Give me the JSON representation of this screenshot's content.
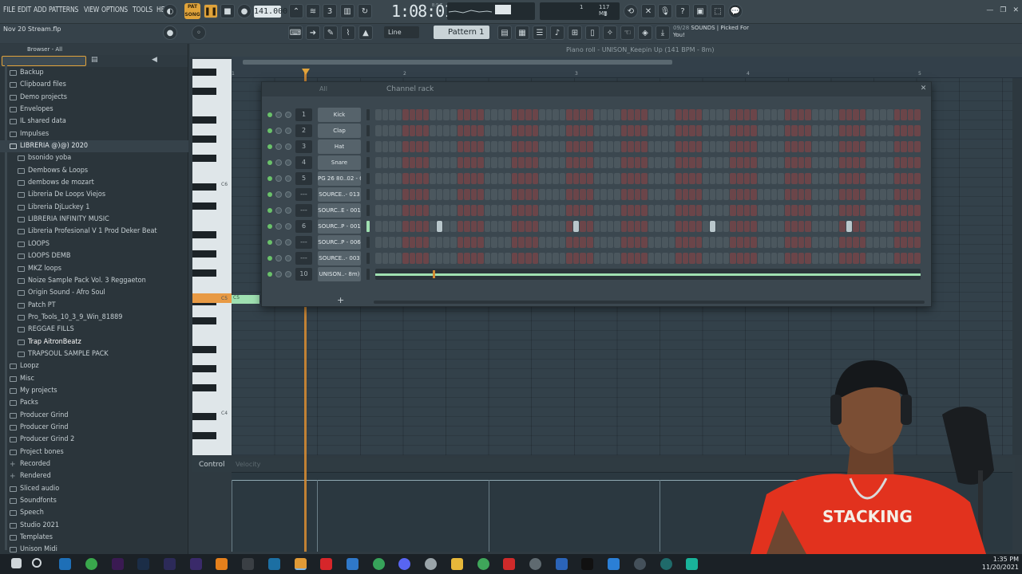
{
  "menu": [
    "FILE",
    "EDIT",
    "ADD",
    "PATTERNS",
    "VIEW",
    "OPTIONS",
    "TOOLS",
    "HELP"
  ],
  "project_file": "Nov 20 Stream.flp",
  "toolbar": {
    "pat_label": "PAT",
    "song_label": "SONG",
    "tempo": "141.000",
    "time": "1:08:01",
    "bst_label": "B:S:T",
    "cpu_number": "1",
    "memory": "117 MB",
    "voices": "1",
    "snap_mode": "Line",
    "pattern_name": "Pattern 1",
    "hint_count": "09/28",
    "hint_text": "SOUNDS | Picked For You!"
  },
  "browser": {
    "title": "Browser - All",
    "items": [
      {
        "label": "Backup",
        "indent": 0,
        "icon": "folder"
      },
      {
        "label": "Clipboard files",
        "indent": 0,
        "icon": "folder"
      },
      {
        "label": "Demo projects",
        "indent": 0,
        "icon": "folder"
      },
      {
        "label": "Envelopes",
        "indent": 0,
        "icon": "folder"
      },
      {
        "label": "IL shared data",
        "indent": 0,
        "icon": "folder"
      },
      {
        "label": "Impulses",
        "indent": 0,
        "icon": "folder"
      },
      {
        "label": "LIBRERIA @)@) 2020",
        "indent": 0,
        "icon": "folder-open",
        "open": true
      },
      {
        "label": "bsonido yoba",
        "indent": 1,
        "icon": "folder"
      },
      {
        "label": "Dembows & Loops",
        "indent": 1,
        "icon": "folder"
      },
      {
        "label": "dembows de mozart",
        "indent": 1,
        "icon": "folder"
      },
      {
        "label": "Libreria De Loops Viejos",
        "indent": 1,
        "icon": "folder"
      },
      {
        "label": "Libreria DjLuckey 1",
        "indent": 1,
        "icon": "folder"
      },
      {
        "label": "LIBRERIA INFINITY MUSIC",
        "indent": 1,
        "icon": "folder"
      },
      {
        "label": "Libreria Profesional V 1 Prod Deker Beat",
        "indent": 1,
        "icon": "folder"
      },
      {
        "label": "LOOPS",
        "indent": 1,
        "icon": "folder"
      },
      {
        "label": "LOOPS DEMB",
        "indent": 1,
        "icon": "folder"
      },
      {
        "label": "MKZ loops",
        "indent": 1,
        "icon": "folder"
      },
      {
        "label": "Noize Sample Pack Vol. 3 Reggaeton",
        "indent": 1,
        "icon": "folder"
      },
      {
        "label": "Origin Sound - Afro Soul",
        "indent": 1,
        "icon": "folder"
      },
      {
        "label": "Patch PT",
        "indent": 1,
        "icon": "folder"
      },
      {
        "label": "Pro_Tools_10_3_9_Win_81889",
        "indent": 1,
        "icon": "folder"
      },
      {
        "label": "REGGAE FILLS",
        "indent": 1,
        "icon": "folder"
      },
      {
        "label": "Trap AitronBeatz",
        "indent": 1,
        "icon": "folder",
        "hl": true
      },
      {
        "label": "TRAPSOUL SAMPLE PACK",
        "indent": 1,
        "icon": "folder"
      },
      {
        "label": "Loopz",
        "indent": 0,
        "icon": "folder"
      },
      {
        "label": "Misc",
        "indent": 0,
        "icon": "folder"
      },
      {
        "label": "My projects",
        "indent": 0,
        "icon": "folder"
      },
      {
        "label": "Packs",
        "indent": 0,
        "icon": "folder"
      },
      {
        "label": "Producer Grind",
        "indent": 0,
        "icon": "folder"
      },
      {
        "label": "Producer Grind",
        "indent": 0,
        "icon": "folder"
      },
      {
        "label": "Producer Grind 2",
        "indent": 0,
        "icon": "folder"
      },
      {
        "label": "Project bones",
        "indent": 0,
        "icon": "folder"
      },
      {
        "label": "Recorded",
        "indent": 0,
        "icon": "plus"
      },
      {
        "label": "Rendered",
        "indent": 0,
        "icon": "plus"
      },
      {
        "label": "Sliced audio",
        "indent": 0,
        "icon": "folder"
      },
      {
        "label": "Soundfonts",
        "indent": 0,
        "icon": "folder"
      },
      {
        "label": "Speech",
        "indent": 0,
        "icon": "folder"
      },
      {
        "label": "Studio 2021",
        "indent": 0,
        "icon": "folder"
      },
      {
        "label": "Templates",
        "indent": 0,
        "icon": "folder"
      },
      {
        "label": "Unison Midi",
        "indent": 0,
        "icon": "folder"
      }
    ]
  },
  "piano_roll": {
    "title": "Piano roll - UNISON_Keepin Up (141 BPM - 8m)",
    "bars": [
      "1",
      "2",
      "3",
      "4",
      "5"
    ],
    "key_labels": [
      "C6",
      "C5",
      "C4"
    ],
    "control_label": "Control",
    "velocity_label": "Velocity"
  },
  "channel_rack": {
    "title": "Channel rack",
    "filter": "All",
    "channels": [
      {
        "num": "1",
        "name": "Kick",
        "on": []
      },
      {
        "num": "2",
        "name": "Clap",
        "on": []
      },
      {
        "num": "3",
        "name": "Hat",
        "on": []
      },
      {
        "num": "4",
        "name": "Snare",
        "on": []
      },
      {
        "num": "5",
        "name": "PG 26 80..02 - C",
        "on": []
      },
      {
        "num": "---",
        "name": "SOURCE..- 013",
        "on": []
      },
      {
        "num": "---",
        "name": "SOURC..E - 001",
        "on": []
      },
      {
        "num": "6",
        "name": "SOURC..P - 001",
        "on": [
          9,
          29,
          49,
          69
        ]
      },
      {
        "num": "---",
        "name": "SOURC..P - 006",
        "on": []
      },
      {
        "num": "---",
        "name": "SOURCE..- 003",
        "on": []
      },
      {
        "num": "10",
        "name": "UNISON..- 8m)",
        "pianoroll": true
      }
    ],
    "steps": 80,
    "add_label": "+"
  },
  "taskbar": {
    "time": "1:35 PM",
    "date": "11/20/2021"
  },
  "colors": {
    "accent": "#e2a33b",
    "note_green": "#9fe0b1",
    "panel": "#3b474f"
  }
}
